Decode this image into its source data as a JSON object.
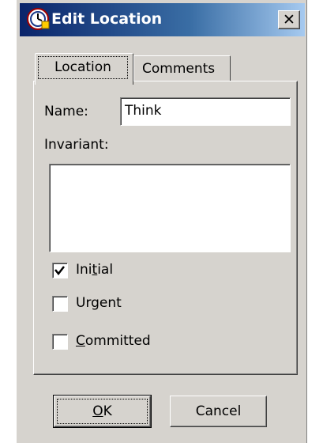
{
  "window": {
    "title": "Edit Location",
    "close_symbol": "✕",
    "icons": {
      "app": "clock-app-icon",
      "close": "close-icon"
    }
  },
  "tabs": [
    {
      "label": "Location",
      "selected": true
    },
    {
      "label": "Comments",
      "selected": false
    }
  ],
  "location": {
    "name_label": "Name:",
    "name_value": "Think",
    "invariant_label": "Invariant:",
    "invariant_value": "",
    "checkboxes": [
      {
        "label": "Initial",
        "checked": true,
        "mnemonic_index": 3
      },
      {
        "label": "Urgent",
        "checked": false
      },
      {
        "label": "Committed",
        "checked": false,
        "mnemonic_index": 0
      }
    ]
  },
  "buttons": {
    "ok_label": "OK",
    "ok_mnemonic_index": 0,
    "cancel_label": "Cancel"
  },
  "colors": {
    "face": "#d6d3ce",
    "title_start": "#0a246a",
    "title_end": "#a6caf0"
  }
}
